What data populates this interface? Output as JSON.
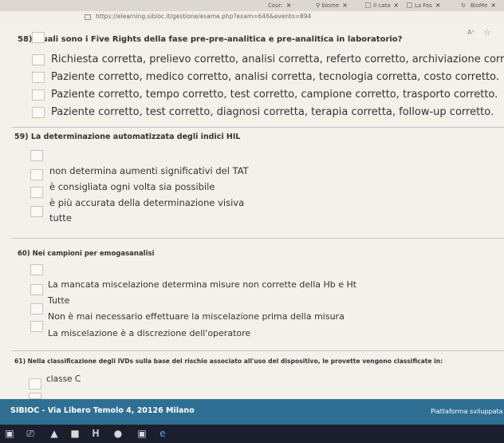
{
  "browser": {
    "tabs": [
      {
        "label": "Cour:",
        "close": "×"
      },
      {
        "label": "biome",
        "close": "×"
      },
      {
        "label": "Il cata",
        "close": "×"
      },
      {
        "label": "La Fas",
        "close": "×"
      },
      {
        "label": "BioMe",
        "close": "×"
      }
    ],
    "url": "https://elearning.sibioc.it/gestione/esame.php?exam=646&evento=894",
    "reader_label": "Aᴬ",
    "star": "☆"
  },
  "questions": [
    {
      "title": "58) Quali sono i Five Rights della fase pre-pre-analitica e pre-analitica in laboratorio?",
      "options": [
        "Richiesta corretta, prelievo corretto, analisi corretta, referto corretto, archiviazione corret",
        "Paziente corretto, medico corretto, analisi corretta, tecnologia corretta, costo corretto.",
        "Paziente corretto, tempo corretto, test corretto, campione corretto, trasporto corretto.",
        "Paziente corretto, test corretto, diagnosi corretta, terapia corretta, follow-up corretto."
      ]
    },
    {
      "title": "59) La determinazione automatizzata degli indici HIL",
      "options": [
        "non determina aumenti significativi del TAT",
        "è consigliata ogni volta sia possibile",
        "è più accurata della determinazione visiva",
        "tutte"
      ]
    },
    {
      "title": "60) Nei campioni per emogasanalisi",
      "options": [
        "La mancata miscelazione determina misure non corrette della Hb e Ht",
        "Tutte",
        "Non è mai necessario effettuare la miscelazione prima della misura",
        "La miscelazione è a discrezione dell'operatore"
      ]
    },
    {
      "title": "61) Nella classificazione degli IVDs sulla base del rischio associato all'uso del dispositivo, le provette vengono classificate in:",
      "options": [
        "classe C"
      ]
    }
  ],
  "footer": {
    "address": "SIBIOC - Via Libero Temolo 4, 20126 Milano",
    "platform": "Piattaforma sviluppata d"
  },
  "taskbar": {
    "items": [
      "start-icon",
      "task-view-icon",
      "network-icon",
      "folder-icon",
      "word-icon",
      "app-icon",
      "files-icon",
      "edge-icon"
    ]
  }
}
